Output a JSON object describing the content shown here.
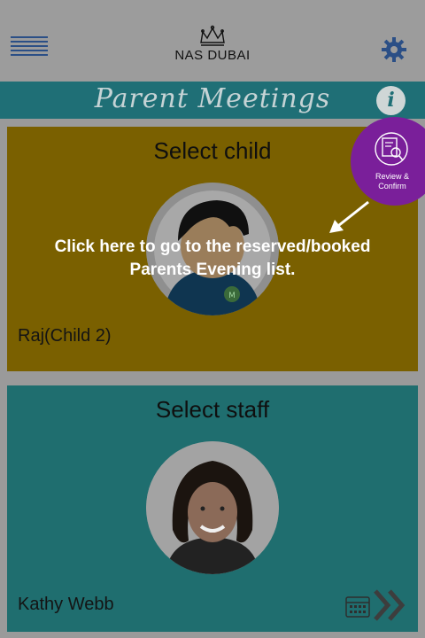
{
  "header": {
    "brand": "NAS DUBAI",
    "title": "Parent Meetings",
    "menu_icon": "hamburger-menu-icon",
    "settings_icon": "gear-icon",
    "info_icon": "info-icon",
    "info_glyph": "i"
  },
  "child_card": {
    "heading": "Select child",
    "name": "Raj(Child 2)",
    "color": "#7a6000"
  },
  "staff_card": {
    "heading": "Select staff",
    "name": "Kathy Webb",
    "color": "#1f6e6f"
  },
  "review": {
    "label": "Review & Confirm",
    "color": "#7a1f9a"
  },
  "hint": {
    "text": "Click here to go to the reserved/booked Parents Evening list."
  },
  "colors": {
    "accent": "#1f6f76",
    "menu": "#2b4f86"
  }
}
